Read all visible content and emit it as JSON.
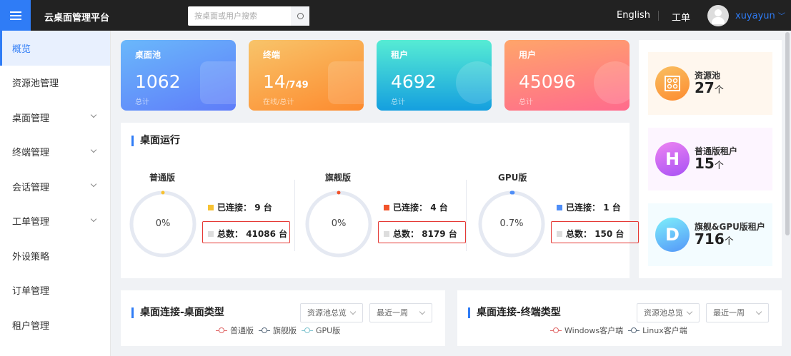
{
  "header": {
    "title": "云桌面管理平台",
    "search_placeholder": "按桌面或用户搜索",
    "language": "English",
    "ticket": "工单",
    "username": "xuyayun"
  },
  "sidebar": {
    "items": [
      {
        "label": "概览",
        "active": true
      },
      {
        "label": "资源池管理"
      },
      {
        "label": "桌面管理",
        "expandable": true
      },
      {
        "label": "终端管理",
        "expandable": true
      },
      {
        "label": "会话管理",
        "expandable": true
      },
      {
        "label": "工单管理",
        "expandable": true
      },
      {
        "label": "外设策略"
      },
      {
        "label": "订单管理"
      },
      {
        "label": "租户管理"
      }
    ]
  },
  "cards": [
    {
      "title": "桌面池",
      "value": "1062",
      "suffix": "",
      "sub": "总计"
    },
    {
      "title": "终端",
      "value": "14",
      "suffix": "/749",
      "sub": "在线/总计"
    },
    {
      "title": "租户",
      "value": "4692",
      "suffix": "",
      "sub": "总计"
    },
    {
      "title": "用户",
      "value": "45096",
      "suffix": "",
      "sub": "总计"
    }
  ],
  "desktop_run": {
    "title": "桌面运行",
    "groups": [
      {
        "name": "普通版",
        "percent": "0%",
        "fraction": 0,
        "connected_label": "已连接：",
        "connected": "9 台",
        "connected_color": "#f7c232",
        "total_label": "总数：",
        "total": "41086 台"
      },
      {
        "name": "旗舰版",
        "percent": "0%",
        "fraction": 0,
        "connected_label": "已连接：",
        "connected": "4 台",
        "connected_color": "#f2532a",
        "total_label": "总数：",
        "total": "8179 台"
      },
      {
        "name": "GPU版",
        "percent": "0.7%",
        "fraction": 0.007,
        "connected_label": "已连接：",
        "connected": "1 台",
        "connected_color": "#4f8ef7",
        "total_label": "总数：",
        "total": "150 台"
      }
    ]
  },
  "stats": [
    {
      "label": "资源池",
      "count": "27",
      "unit": "个",
      "icon": "resource-pool-icon"
    },
    {
      "label": "普通版租户",
      "count": "15",
      "unit": "个",
      "icon": "H"
    },
    {
      "label": "旗舰&GPU版租户",
      "count": "716",
      "unit": "个",
      "icon": "D"
    }
  ],
  "bottom": [
    {
      "title": "桌面连接-桌面类型",
      "select1": "资源池总览",
      "select2": "最近一周",
      "legend": [
        {
          "label": "普通版",
          "color": "#e06666"
        },
        {
          "label": "旗舰版",
          "color": "#5a6b7d"
        },
        {
          "label": "GPU版",
          "color": "#7fc4cf"
        }
      ]
    },
    {
      "title": "桌面连接-终端类型",
      "select1": "资源池总览",
      "select2": "最近一周",
      "legend": [
        {
          "label": "Windows客户端",
          "color": "#e06666"
        },
        {
          "label": "Linux客户端",
          "color": "#5a6b7d"
        }
      ]
    }
  ]
}
